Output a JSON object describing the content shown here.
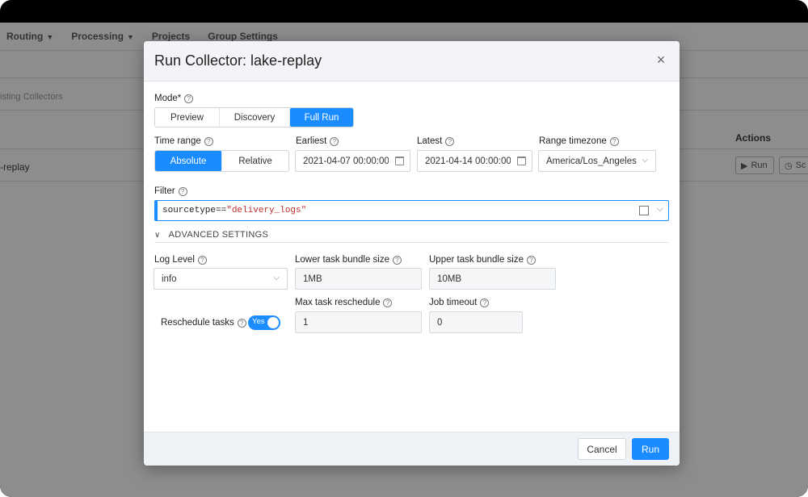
{
  "background": {
    "nav": [
      {
        "label": "Routing",
        "has_dropdown": true
      },
      {
        "label": "Processing",
        "has_dropdown": true
      },
      {
        "label": "Projects",
        "has_dropdown": false
      },
      {
        "label": "Group Settings",
        "has_dropdown": false
      }
    ],
    "search_placeholder": "isting Collectors",
    "actions_header": "Actions",
    "row_name": "-replay",
    "row_buttons": {
      "run": "Run",
      "schedule": "Sc"
    }
  },
  "modal": {
    "title": "Run Collector: lake-replay",
    "close_glyph": "×",
    "mode": {
      "label": "Mode*",
      "options": [
        "Preview",
        "Discovery",
        "Full Run"
      ],
      "selected": "Full Run"
    },
    "time_range": {
      "label": "Time range",
      "options": [
        "Absolute",
        "Relative"
      ],
      "selected": "Absolute"
    },
    "earliest": {
      "label": "Earliest",
      "value": "2021-04-07 00:00:00"
    },
    "latest": {
      "label": "Latest",
      "value": "2021-04-14 00:00:00"
    },
    "range_timezone": {
      "label": "Range timezone",
      "value": "America/Los_Angeles"
    },
    "filter": {
      "label": "Filter",
      "key": "sourcetype",
      "operator": "==",
      "value": "\"delivery_logs\""
    },
    "advanced_settings": {
      "label": "ADVANCED SETTINGS",
      "log_level": {
        "label": "Log Level",
        "value": "info"
      },
      "lower_bundle": {
        "label": "Lower task bundle size",
        "value": "1MB"
      },
      "upper_bundle": {
        "label": "Upper task bundle size",
        "value": "10MB"
      },
      "reschedule_tasks": {
        "label": "Reschedule tasks",
        "toggle_text": "Yes",
        "enabled": true
      },
      "max_reschedule": {
        "label": "Max task reschedule",
        "value": "1"
      },
      "job_timeout": {
        "label": "Job timeout",
        "value": "0"
      }
    },
    "footer": {
      "cancel": "Cancel",
      "run": "Run"
    }
  },
  "colors": {
    "accent": "#1a8cff",
    "filter_string": "#c0302b",
    "overlay_bg": "#8d8d8d"
  }
}
